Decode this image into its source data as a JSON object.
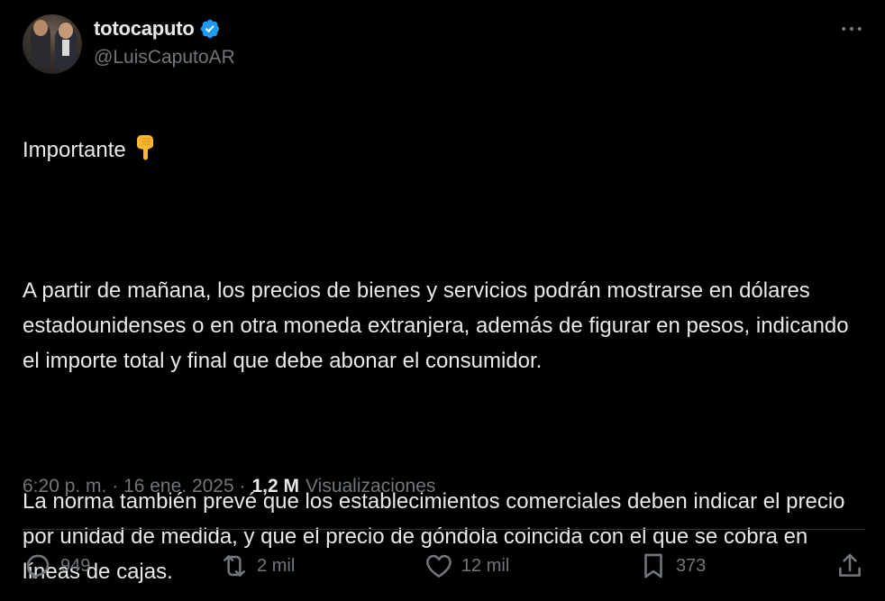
{
  "author": {
    "display_name": "totocaputo",
    "handle": "@LuisCaputoAR",
    "verified": true,
    "accent_color": "#1d9bf0"
  },
  "tweet": {
    "paragraphs": [
      "Importante",
      "A partir de mañana, los precios de bienes y servicios podrán mostrarse en dólares estadounidenses o en otra moneda extranjera, además de figurar en pesos, indicando el importe total y final que debe abonar el consumidor.",
      "La norma también prevé que los establecimientos comerciales deben indicar el precio por unidad de medida, y que el precio de góndola coincida con el que se cobra en líneas de cajas."
    ],
    "emoji": "backhand-index-pointing-down"
  },
  "meta": {
    "timestamp": "6:20 p. m. · 16 ene. 2025 ·",
    "views_count": "1,2 M",
    "views_label": "Visualizaciones"
  },
  "actions": {
    "replies": "949",
    "reposts": "2 mil",
    "likes": "12 mil",
    "bookmarks": "373"
  },
  "colors": {
    "background": "#000000",
    "text": "#e7e9ea",
    "muted": "#71767b",
    "divider": "#2f3336"
  }
}
